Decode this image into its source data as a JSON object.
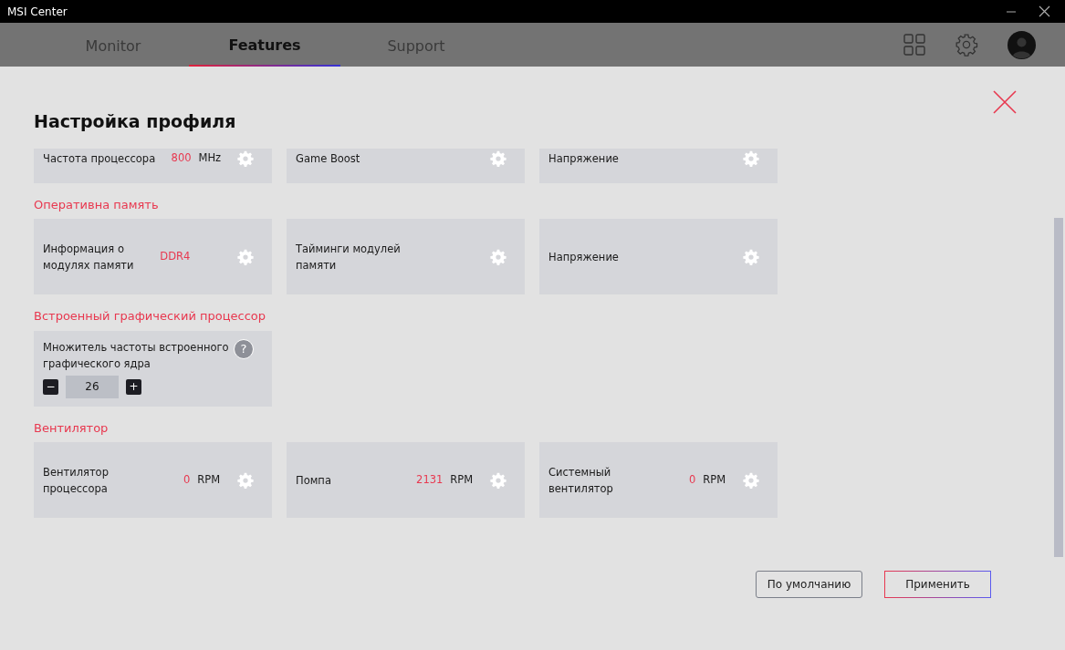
{
  "window": {
    "title": "MSI Center"
  },
  "tabs": [
    {
      "label": "Monitor",
      "selected": false
    },
    {
      "label": "Features",
      "selected": true
    },
    {
      "label": "Support",
      "selected": false
    }
  ],
  "panel": {
    "title": "Настройка профиля"
  },
  "top_row": [
    {
      "kind": "setting",
      "label": "Частота процессора",
      "value": "800",
      "unit": "MHz"
    },
    {
      "kind": "setting",
      "label": "Game Boost"
    },
    {
      "kind": "setting",
      "label": "Напряжение"
    }
  ],
  "sections": [
    {
      "heading": "Оперативна память",
      "cards": [
        {
          "kind": "setting",
          "label": "Информация о модулях памяти",
          "value": "DDR4"
        },
        {
          "kind": "setting",
          "label": "Тайминги модулей памяти"
        },
        {
          "kind": "setting",
          "label": "Напряжение"
        }
      ]
    },
    {
      "heading": "Встроенный графический процессор",
      "cards": [
        {
          "kind": "stepper",
          "label": "Множитель частоты встроенного графического ядра",
          "help": "?",
          "decrement": "−",
          "value": "26",
          "increment": "+"
        }
      ]
    },
    {
      "heading": "Вентилятор",
      "cards": [
        {
          "kind": "setting",
          "label": "Вентилятор процессора",
          "value": "0",
          "unit": "RPM"
        },
        {
          "kind": "setting",
          "label": "Помпа",
          "value": "2131",
          "unit": "RPM"
        },
        {
          "kind": "setting",
          "label": "Системный вентилятор",
          "value": "0",
          "unit": "RPM"
        }
      ]
    }
  ],
  "buttons": [
    {
      "label": "По умолчанию",
      "kind": "default"
    },
    {
      "label": "Применить",
      "kind": "primary"
    }
  ]
}
